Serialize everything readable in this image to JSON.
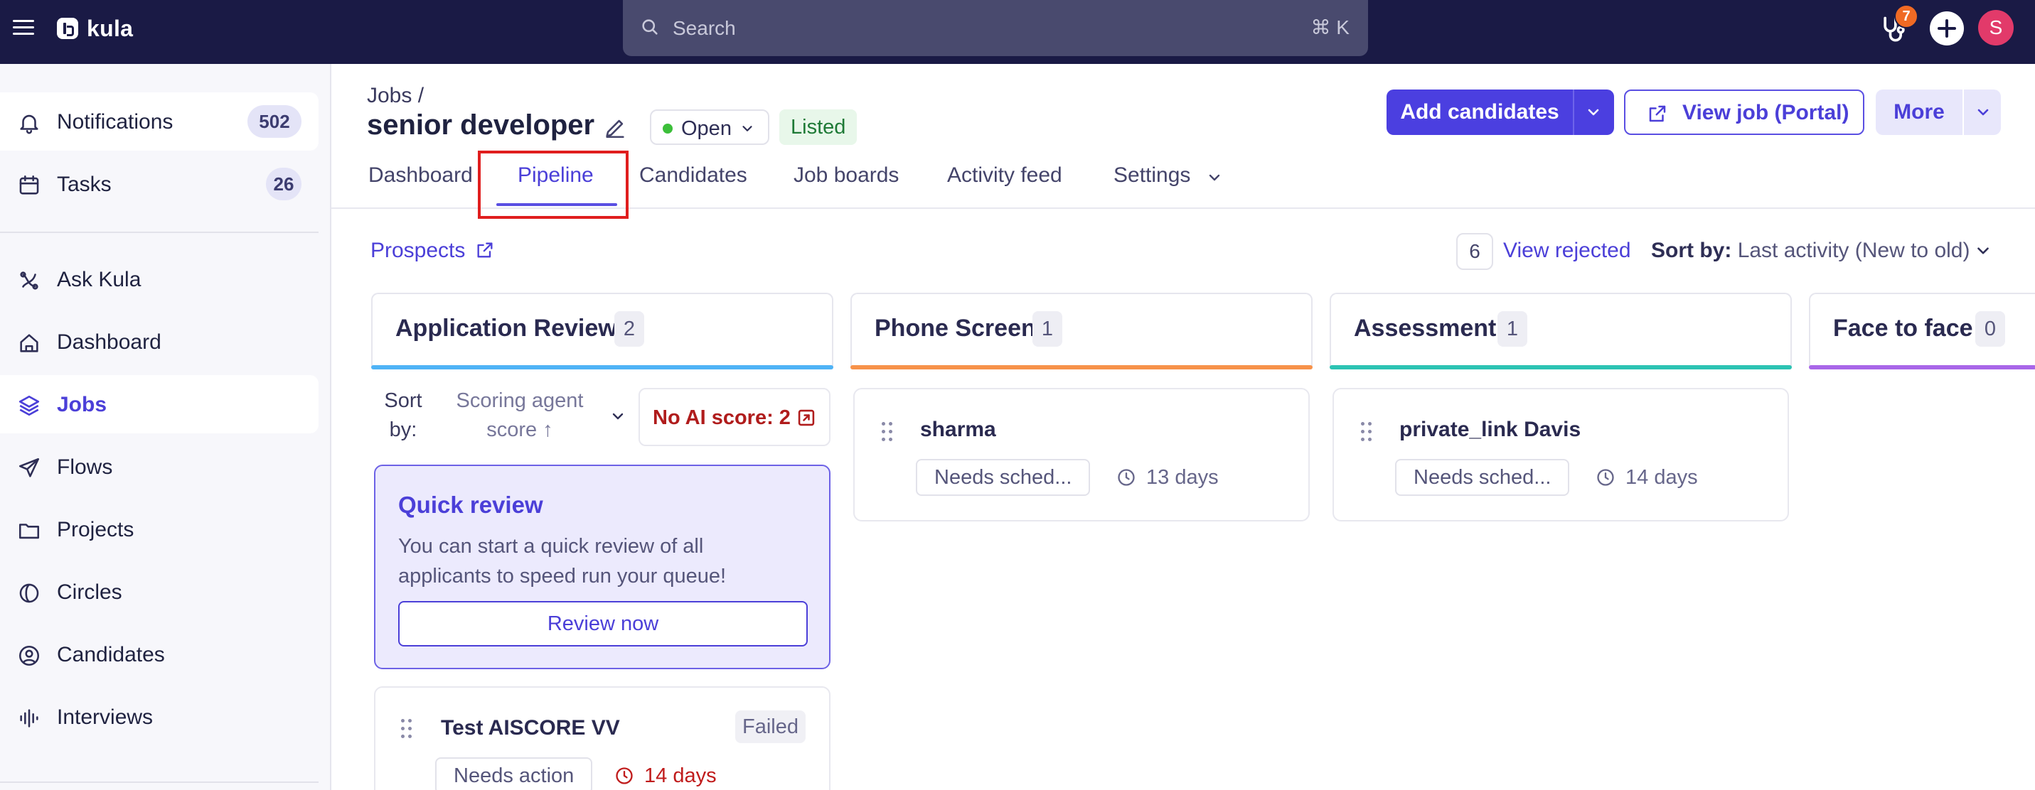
{
  "topbar": {
    "logo_text": "kula",
    "search_placeholder": "Search",
    "search_shortcut": "⌘ K",
    "notification_count": "7",
    "avatar_initial": "S",
    "accent_color": "#1a1a45"
  },
  "sidebar": {
    "items": [
      {
        "label": "Notifications",
        "count": "502",
        "icon": "bell-icon"
      },
      {
        "label": "Tasks",
        "count": "26",
        "icon": "calendar-icon"
      },
      {
        "label": "Ask Kula",
        "icon": "sparkle-icon"
      },
      {
        "label": "Dashboard",
        "icon": "home-icon"
      },
      {
        "label": "Jobs",
        "icon": "layers-icon",
        "active": true
      },
      {
        "label": "Flows",
        "icon": "send-icon"
      },
      {
        "label": "Projects",
        "icon": "folder-icon"
      },
      {
        "label": "Circles",
        "icon": "circles-icon"
      },
      {
        "label": "Candidates",
        "icon": "user-circle-icon"
      },
      {
        "label": "Interviews",
        "icon": "audio-bars-icon"
      }
    ]
  },
  "header": {
    "breadcrumb": "Jobs /",
    "title": "senior developer",
    "status": "Open",
    "listed": "Listed",
    "add_candidates": "Add candidates",
    "view_job": "View job (Portal)",
    "more": "More"
  },
  "tabs": [
    "Dashboard",
    "Pipeline",
    "Candidates",
    "Job boards",
    "Activity feed",
    "Settings"
  ],
  "active_tab": "Pipeline",
  "subbar": {
    "prospects": "Prospects",
    "rejected_count": "6",
    "view_rejected": "View rejected",
    "sort_by_label": "Sort by:",
    "sort_by_value": "Last activity (New to old)"
  },
  "columns": [
    {
      "title": "Application Review",
      "count": "2",
      "color": "#4fb3f6"
    },
    {
      "title": "Phone Screen",
      "count": "1",
      "color": "#f7924a"
    },
    {
      "title": "Assessment",
      "count": "1",
      "color": "#2cc3b3"
    },
    {
      "title": "Face to face",
      "count": "0",
      "color": "#a866e8"
    }
  ],
  "app_review": {
    "sort_label": "Sort by:",
    "sort_value": "Scoring agent score ↑",
    "no_ai_score": "No AI score: 2",
    "quick_review": {
      "title": "Quick review",
      "body": "You can start a quick review of all applicants to speed run your queue!",
      "button": "Review now"
    },
    "card": {
      "name": "Test AISCORE VV",
      "status": "Failed",
      "tag": "Needs action",
      "days": "14 days",
      "days_color": "#c01c1c"
    }
  },
  "phone_screen": {
    "card": {
      "name": "sharma",
      "tag": "Needs sched...",
      "days": "13 days"
    }
  },
  "assessment": {
    "card": {
      "name": "private_link Davis",
      "tag": "Needs sched...",
      "days": "14 days"
    }
  }
}
